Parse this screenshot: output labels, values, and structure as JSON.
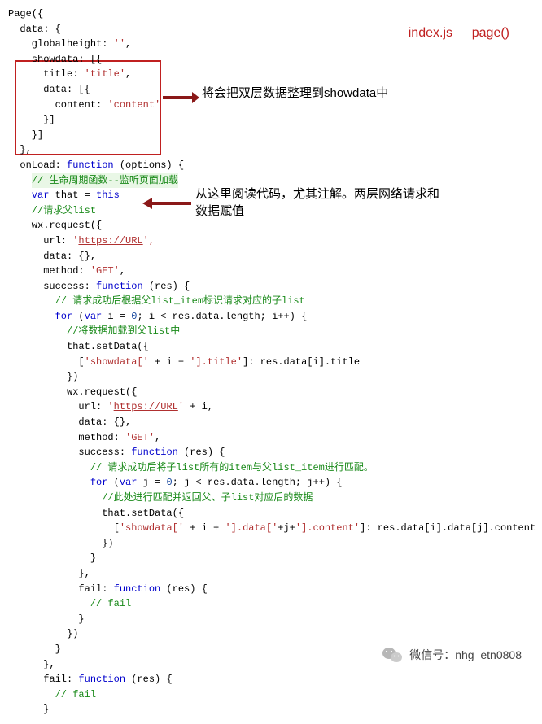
{
  "header": {
    "file": "index.js",
    "func": "page()"
  },
  "annotations": {
    "a1": "将会把双层数据整理到showdata中",
    "a2_line1": "从这里阅读代码，尤其注解。两层网络请求和",
    "a2_line2": "数据赋值"
  },
  "wechat": {
    "label": "微信号：nhg_etn0808"
  },
  "code": {
    "l1": "Page({",
    "l2": "  data: {",
    "l3": "    globalheight: ",
    "l3s": "''",
    "l3e": ",",
    "l4": "    showdata: [{",
    "l5": "      title: ",
    "l5s": "'title'",
    "l5e": ",",
    "l6": "      data: [{",
    "l7": "        content: ",
    "l7s": "'content'",
    "l8": "      }]",
    "l9": "    }]",
    "l10": "  },",
    "l11a": "  onLoad: ",
    "l11k": "function",
    "l11b": " (options) {",
    "l12": "    ",
    "l12c": "// 生命周期函数--监听页面加载",
    "l13a": "    ",
    "l13k": "var",
    "l13b": " that = ",
    "l13t": "this",
    "l14": "    ",
    "l14c": "//请求父list",
    "l15": "    wx.request({",
    "l16": "      url: ",
    "l16s": "'",
    "l16u": "https://URL",
    "l16e": "',",
    "l17": "      data: {},",
    "l18": "      method: ",
    "l18s": "'GET'",
    "l18e": ",",
    "l19a": "      success: ",
    "l19k": "function",
    "l19b": " (res) {",
    "l20": "        ",
    "l20c": "// 请求成功后根据父list_item标识请求对应的子list",
    "l21a": "        ",
    "l21k1": "for",
    "l21b": " (",
    "l21k2": "var",
    "l21c": " i = ",
    "l21n": "0",
    "l21d": "; i < res.data.length; i++) {",
    "l22": "          ",
    "l22c": "//将数据加载到父list中",
    "l23": "          that.setData({",
    "l24a": "            [",
    "l24s1": "'showdata['",
    "l24b": " + i + ",
    "l24s2": "'].title'",
    "l24c": "]: res.data[i].title",
    "l25": "          })",
    "l26": "          wx.request({",
    "l27": "            url: ",
    "l27s": "'",
    "l27u": "https://URL",
    "l27e": "'",
    "l27b": " + i,",
    "l28": "            data: {},",
    "l29": "            method: ",
    "l29s": "'GET'",
    "l29e": ",",
    "l30a": "            success: ",
    "l30k": "function",
    "l30b": " (res) {",
    "l31": "              ",
    "l31c": "// 请求成功后将子list所有的item与父list_item进行匹配。",
    "l32a": "              ",
    "l32k1": "for",
    "l32b": " (",
    "l32k2": "var",
    "l32c": " j = ",
    "l32n": "0",
    "l32d": "; j < res.data.length; j++) {",
    "l33": "                ",
    "l33c": "//此处进行匹配并返回父、子list对应后的数据",
    "l34": "                that.setData({",
    "l35a": "                  [",
    "l35s1": "'showdata['",
    "l35b": " + i + ",
    "l35s2": "'].data['",
    "l35c": "+j+",
    "l35s3": "'].content'",
    "l35d": "]: res.data[i].data[j].content",
    "l36": "                })",
    "l37": "              }",
    "l38": "            },",
    "l39a": "            fail: ",
    "l39k": "function",
    "l39b": " (res) {",
    "l40": "              ",
    "l40c": "// fail",
    "l41": "            }",
    "l42": "          })",
    "l43": "        }",
    "l44": "      },",
    "l45a": "      fail: ",
    "l45k": "function",
    "l45b": " (res) {",
    "l46": "        ",
    "l46c": "// fail",
    "l47": "      }"
  }
}
